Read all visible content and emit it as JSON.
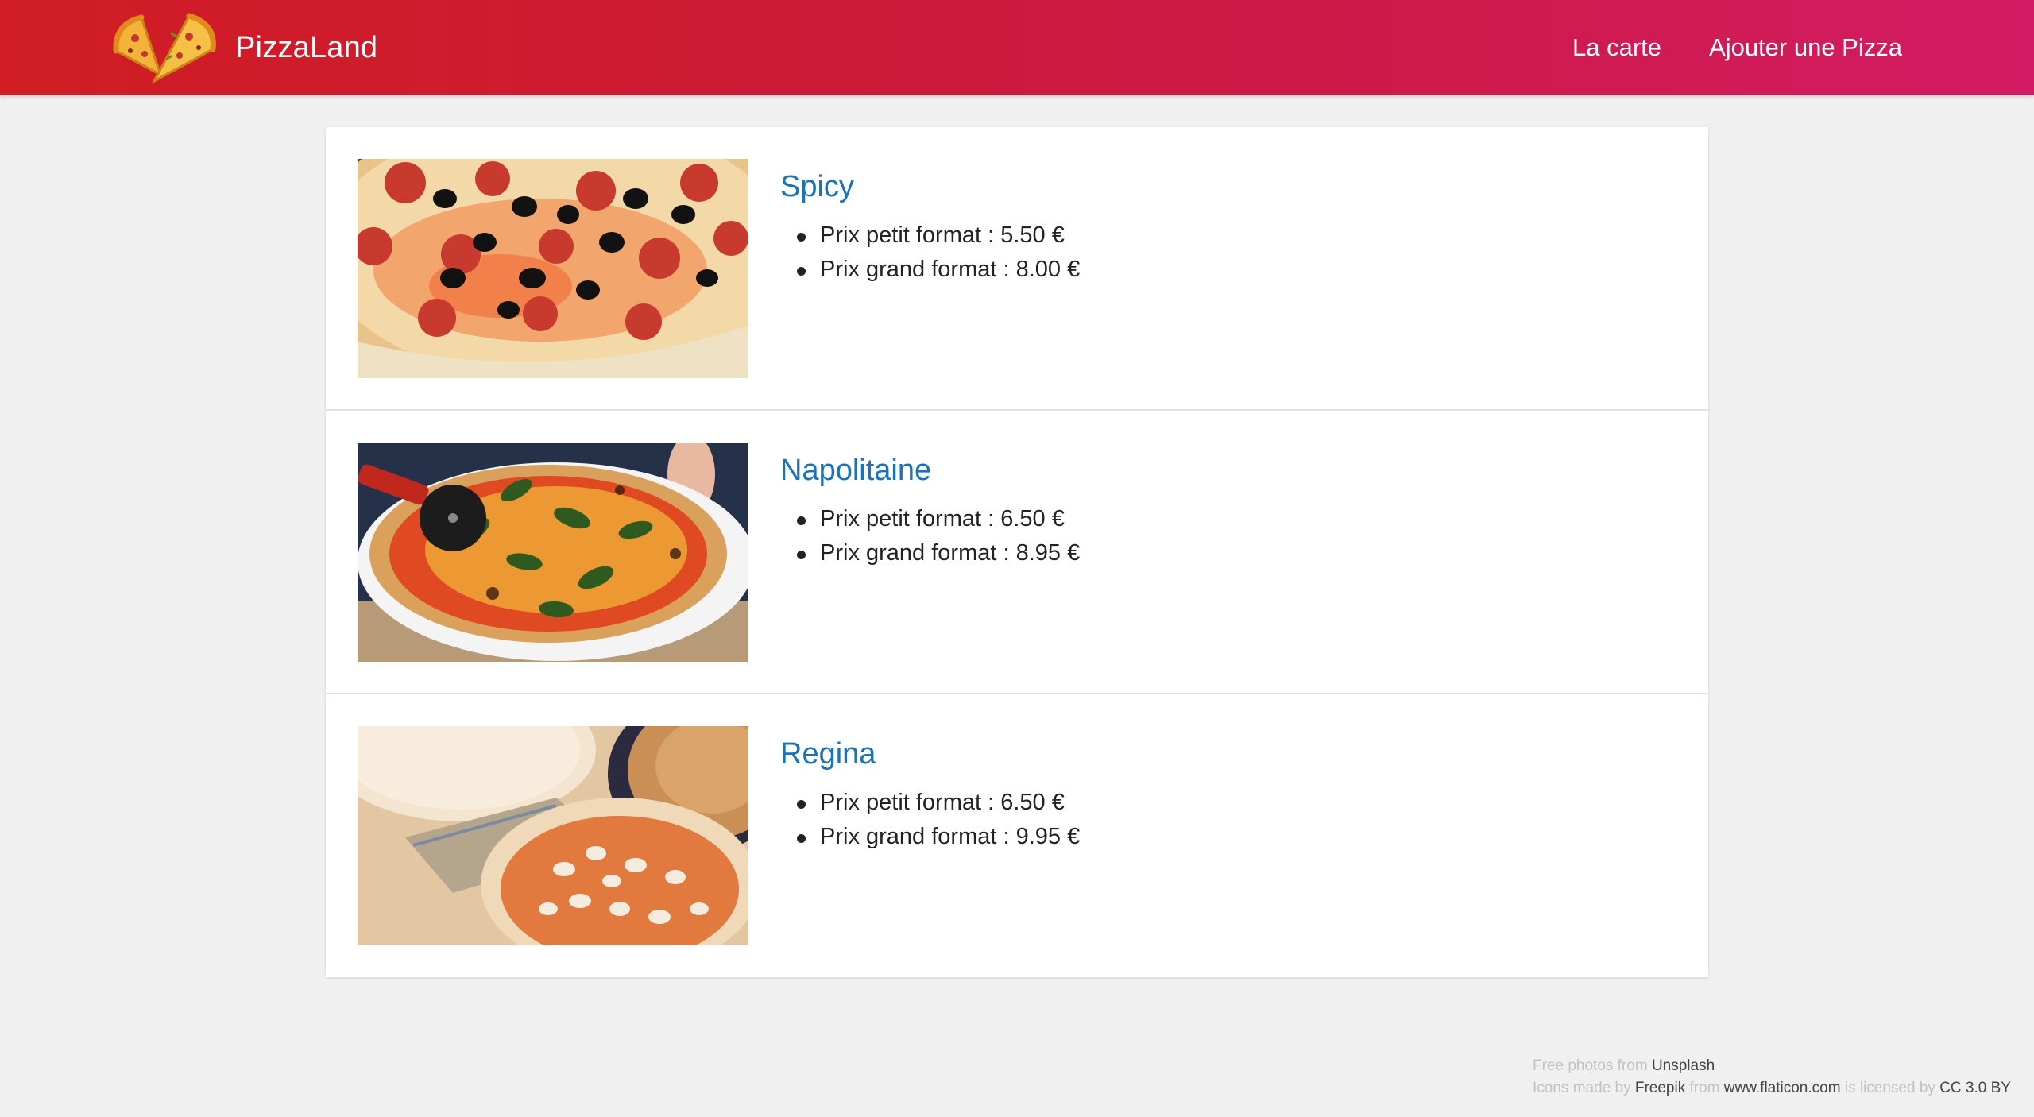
{
  "header": {
    "brand": "PizzaLand",
    "nav": [
      {
        "label": "La carte"
      },
      {
        "label": "Ajouter une Pizza"
      }
    ]
  },
  "pizzas": [
    {
      "name": "Spicy",
      "prix_petit": "Prix petit format : 5.50 €",
      "prix_grand": "Prix grand format : 8.00 €"
    },
    {
      "name": "Napolitaine",
      "prix_petit": "Prix petit format : 6.50 €",
      "prix_grand": "Prix grand format : 8.95 €"
    },
    {
      "name": "Regina",
      "prix_petit": "Prix petit format : 6.50 €",
      "prix_grand": "Prix grand format : 9.95 €"
    }
  ],
  "footer": {
    "photos_prefix": "Free photos from",
    "photos_link": "Unsplash",
    "icons_prefix": "Icons made by",
    "icons_author": "Freepik",
    "from_text": "from",
    "icons_site": "www.flaticon.com",
    "licensed_text": "is licensed by",
    "license": "CC 3.0 BY"
  },
  "colors": {
    "header_start": "#d11d23",
    "header_end": "#d21b62",
    "pizza_name": "#1a73b8",
    "background": "#f0f0f0"
  },
  "icons": {
    "logo": "pizza-slices-icon"
  }
}
